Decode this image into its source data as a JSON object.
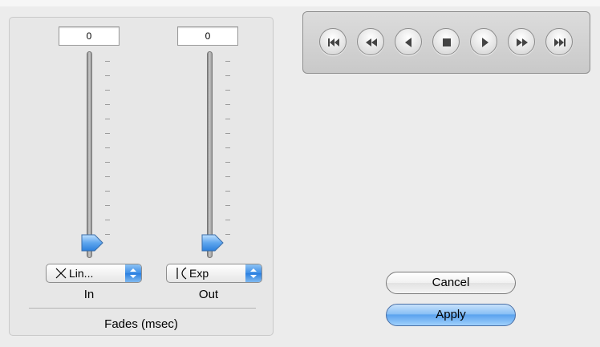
{
  "fades": {
    "group_label": "Fades (msec)",
    "in": {
      "value": "0",
      "curve": "Lin...",
      "curve_icon": "linear-curve-icon",
      "label": "In"
    },
    "out": {
      "value": "0",
      "curve": "Exp",
      "curve_icon": "exp-curve-icon",
      "label": "Out"
    }
  },
  "transport": {
    "buttons": [
      "skip-to-start",
      "rewind",
      "play-reverse",
      "stop",
      "play",
      "fast-forward",
      "skip-to-end"
    ]
  },
  "dialog": {
    "cancel": "Cancel",
    "apply": "Apply"
  },
  "colors": {
    "accent": "#4f9ae9",
    "panel": "#e7e7e7",
    "background": "#ececec"
  }
}
